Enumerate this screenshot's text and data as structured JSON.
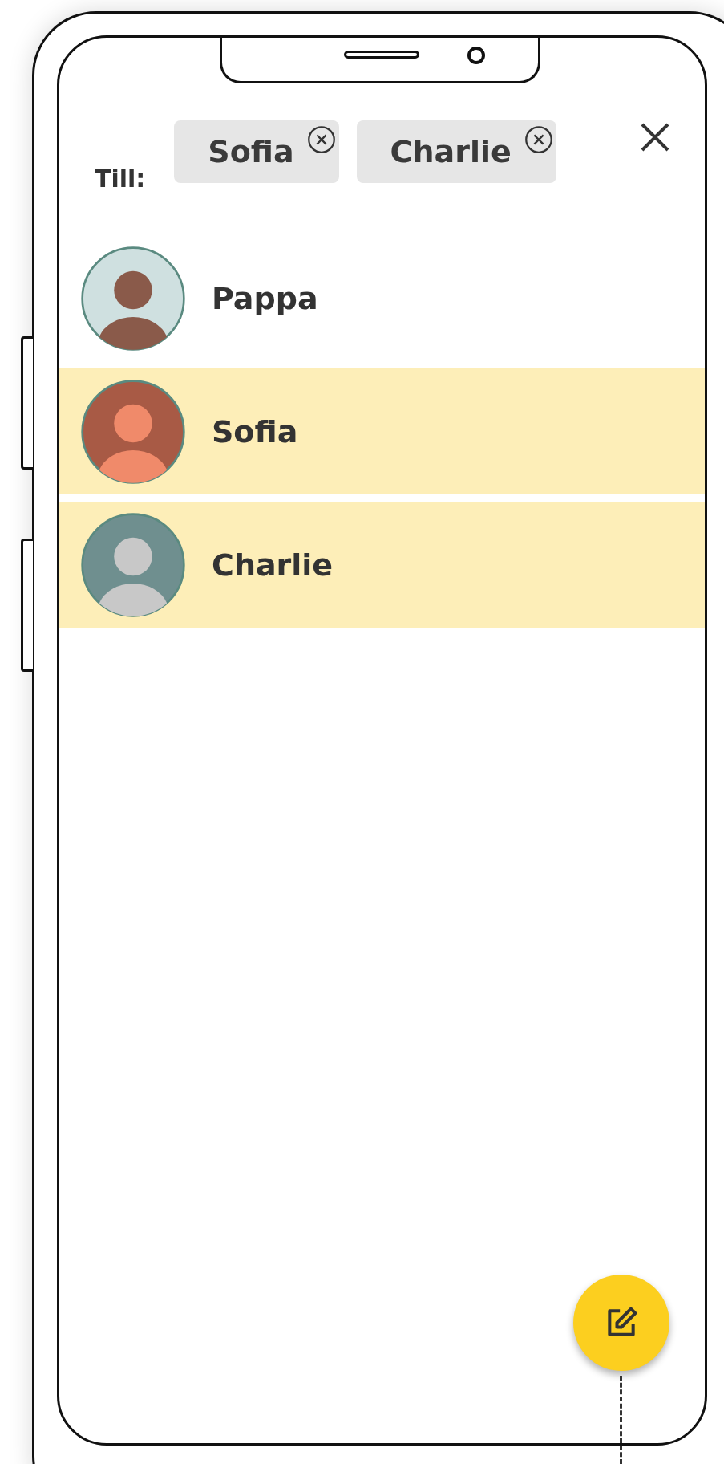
{
  "header": {
    "to_label": "Till:",
    "recipients": [
      {
        "name": "Sofia"
      },
      {
        "name": "Charlie"
      }
    ]
  },
  "contacts": [
    {
      "name": "Pappa",
      "selected": false
    },
    {
      "name": "Sofia",
      "selected": true
    },
    {
      "name": "Charlie",
      "selected": true
    }
  ]
}
